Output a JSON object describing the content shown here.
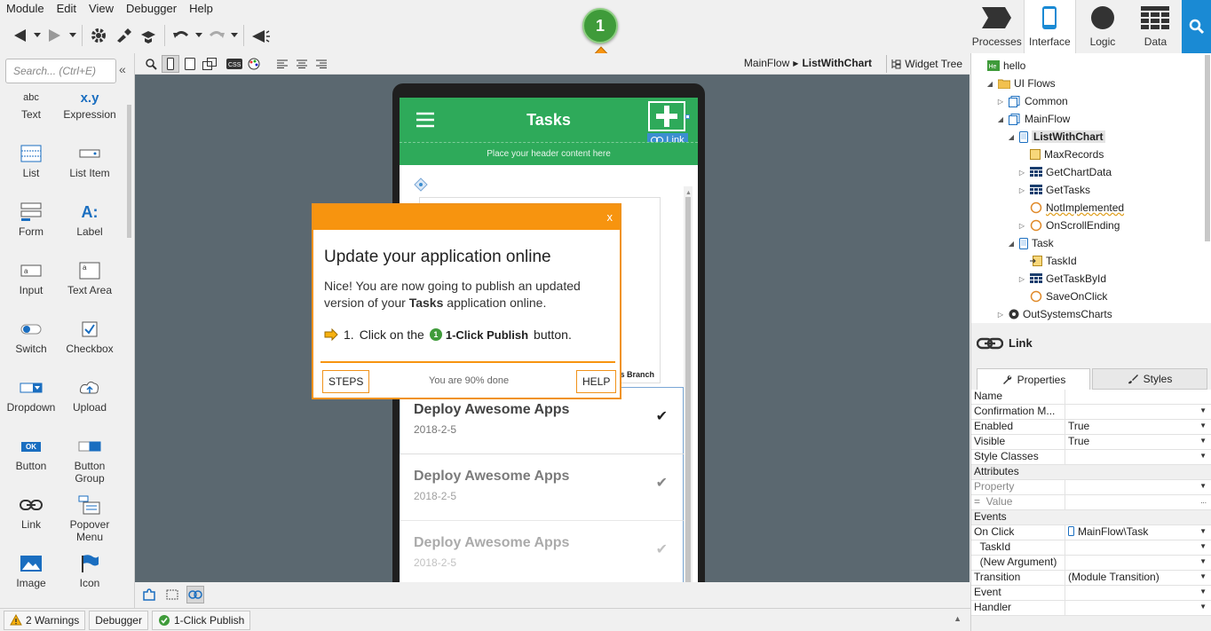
{
  "menu": [
    "Module",
    "Edit",
    "View",
    "Debugger",
    "Help"
  ],
  "top_tabs": [
    {
      "label": "Processes",
      "icon": "processes-icon"
    },
    {
      "label": "Interface",
      "icon": "interface-icon"
    },
    {
      "label": "Logic",
      "icon": "logic-icon"
    },
    {
      "label": "Data",
      "icon": "data-icon"
    }
  ],
  "palette": {
    "search_placeholder": "Search... (Ctrl+E)",
    "items": [
      {
        "label": "Text",
        "icon": "text-widget-icon"
      },
      {
        "label": "Expression",
        "icon": "expression-widget-icon"
      },
      {
        "label": "List",
        "icon": "list-widget-icon"
      },
      {
        "label": "List Item",
        "icon": "list-item-widget-icon"
      },
      {
        "label": "Form",
        "icon": "form-widget-icon"
      },
      {
        "label": "Label",
        "icon": "label-widget-icon"
      },
      {
        "label": "Input",
        "icon": "input-widget-icon"
      },
      {
        "label": "Text Area",
        "icon": "textarea-widget-icon"
      },
      {
        "label": "Switch",
        "icon": "switch-widget-icon"
      },
      {
        "label": "Checkbox",
        "icon": "checkbox-widget-icon"
      },
      {
        "label": "Dropdown",
        "icon": "dropdown-widget-icon"
      },
      {
        "label": "Upload",
        "icon": "upload-widget-icon"
      },
      {
        "label": "Button",
        "icon": "button-widget-icon"
      },
      {
        "label": "Button Group",
        "icon": "button-group-widget-icon"
      },
      {
        "label": "Link",
        "icon": "link-widget-icon"
      },
      {
        "label": "Popover Menu",
        "icon": "popover-menu-widget-icon"
      },
      {
        "label": "Image",
        "icon": "image-widget-icon"
      },
      {
        "label": "Icon",
        "icon": "icon-widget-icon"
      }
    ],
    "text_sample": "abc",
    "expression_sample": "x.y",
    "label_sample": "A:",
    "button_sample": "OK"
  },
  "breadcrumb": {
    "flow": "MainFlow",
    "screen": "ListWithChart"
  },
  "widget_tree_label": "Widget Tree",
  "app_preview": {
    "title": "Tasks",
    "header_placeholder": "Place your header content here",
    "link_tag": "Link",
    "chart_legend_fragment": "s Branch",
    "tasks": [
      {
        "title": "Deploy Awesome Apps",
        "date": "2018-2-5"
      },
      {
        "title": "Deploy Awesome Apps",
        "date": "2018-2-5"
      },
      {
        "title": "Deploy Awesome Apps",
        "date": "2018-2-5"
      }
    ]
  },
  "tour": {
    "close": "x",
    "title": "Update your application online",
    "body_prefix": "Nice! You are now going to publish an updated version of your ",
    "body_app": "Tasks",
    "body_suffix": " application online.",
    "step_number": "1.",
    "step_prefix": "Click on the",
    "step_badge": "1",
    "step_button": "1-Click Publish",
    "step_suffix": "button.",
    "steps_btn": "STEPS",
    "progress": "You are 90% done",
    "help_btn": "HELP"
  },
  "step_badge": "1",
  "status_bar": {
    "warnings": "2 Warnings",
    "debugger": "Debugger",
    "publish": "1-Click Publish"
  },
  "tree": [
    {
      "label": "hello",
      "indent": 0,
      "toggle": "",
      "icon": "module-icon"
    },
    {
      "label": "UI Flows",
      "indent": 1,
      "toggle": "◢",
      "icon": "folder-icon"
    },
    {
      "label": "Common",
      "indent": 2,
      "toggle": "▷",
      "icon": "ui-flow-icon"
    },
    {
      "label": "MainFlow",
      "indent": 2,
      "toggle": "◢",
      "icon": "ui-flow-icon"
    },
    {
      "label": "ListWithChart",
      "indent": 3,
      "toggle": "◢",
      "icon": "screen-icon",
      "selected": true
    },
    {
      "label": "MaxRecords",
      "indent": 4,
      "toggle": "",
      "icon": "variable-icon"
    },
    {
      "label": "GetChartData",
      "indent": 4,
      "toggle": "▷",
      "icon": "aggregate-icon"
    },
    {
      "label": "GetTasks",
      "indent": 4,
      "toggle": "▷",
      "icon": "aggregate-icon"
    },
    {
      "label": "NotImplemented",
      "indent": 4,
      "toggle": "",
      "icon": "action-icon",
      "warning": true
    },
    {
      "label": "OnScrollEnding",
      "indent": 4,
      "toggle": "▷",
      "icon": "action-icon"
    },
    {
      "label": "Task",
      "indent": 3,
      "toggle": "◢",
      "icon": "screen-icon"
    },
    {
      "label": "TaskId",
      "indent": 4,
      "toggle": "",
      "icon": "input-parameter-icon"
    },
    {
      "label": "GetTaskById",
      "indent": 4,
      "toggle": "▷",
      "icon": "aggregate-icon"
    },
    {
      "label": "SaveOnClick",
      "indent": 4,
      "toggle": "",
      "icon": "action-icon"
    },
    {
      "label": "OutSystemsCharts",
      "indent": 2,
      "toggle": "▷",
      "icon": "reference-icon"
    }
  ],
  "properties": {
    "title": "Link",
    "tabs": [
      "Properties",
      "Styles"
    ],
    "rows": [
      {
        "key": "Name",
        "value": "",
        "dd": false
      },
      {
        "key": "Confirmation M...",
        "value": "",
        "dd": true
      },
      {
        "key": "Enabled",
        "value": "True",
        "dd": true
      },
      {
        "key": "Visible",
        "value": "True",
        "dd": true
      },
      {
        "key": "Style Classes",
        "value": "",
        "dd": true
      },
      {
        "key": "Attributes",
        "value": "",
        "section": true
      },
      {
        "key": "Property",
        "value": "",
        "dd": true,
        "dim": true
      },
      {
        "key": "=  Value",
        "value": "",
        "more": "...",
        "dim": true
      },
      {
        "key": "Events",
        "value": "",
        "section": true
      },
      {
        "key": "On Click",
        "value": "MainFlow\\Task",
        "dd": true
      },
      {
        "key": "  TaskId",
        "value": "",
        "dd": true
      },
      {
        "key": "  (New Argument)",
        "value": "",
        "dd": true
      },
      {
        "key": "Transition",
        "value": "(Module Transition)",
        "dd": true
      },
      {
        "key": "Event",
        "value": "",
        "dd": true
      },
      {
        "key": "Handler",
        "value": "",
        "dd": true
      }
    ]
  },
  "colors": {
    "accent_blue": "#1a8ad4",
    "app_green": "#2eaa5a",
    "tour_orange": "#f7940f",
    "canvas_bg": "#5b6870"
  }
}
